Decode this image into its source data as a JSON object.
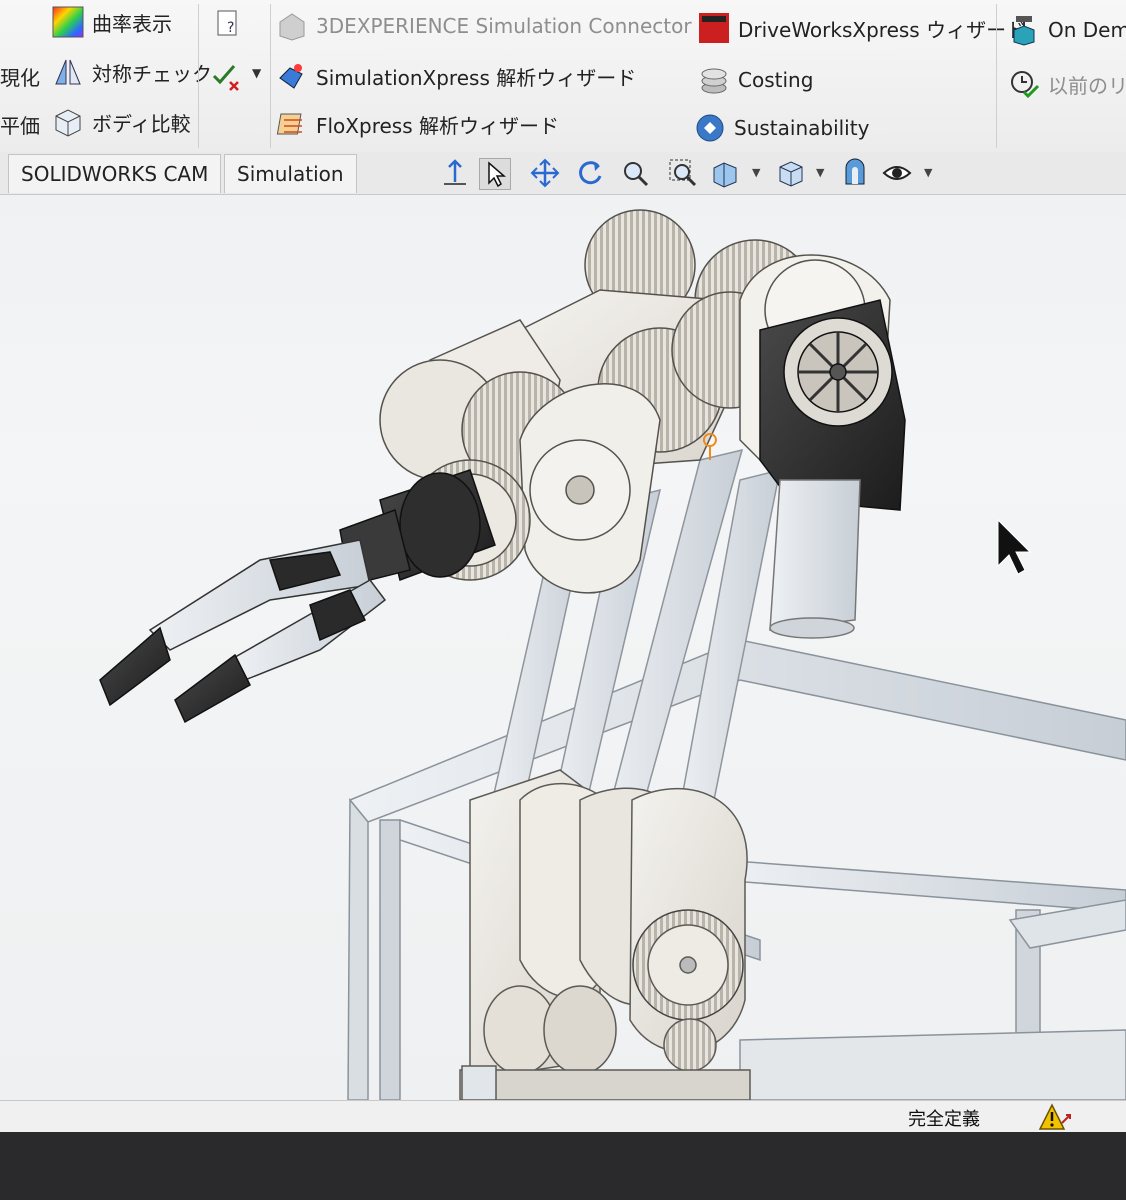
{
  "ribbon": {
    "col1": {
      "curvature": "曲率表示",
      "symmetry_check": "対称チェック",
      "body_compare": "ボディ比較",
      "cut_left_1": "現化",
      "cut_left_2": "平価"
    },
    "sim_connector": "3DEXPERIENCE Simulation Connector",
    "simxpress": "SimulationXpress 解析ウィザード",
    "floxpress": "FloXpress 解析ウィザード",
    "driveworks": "DriveWorksXpress ウィザード",
    "costing": "Costing",
    "sustainability": "Sustainability",
    "on_demand": "On Dem",
    "previous_release": "以前のリ",
    "driveworks_logo_text": "Drive Works"
  },
  "tabs": [
    {
      "label": "SOLIDWORKS CAM"
    },
    {
      "label": "Simulation"
    }
  ],
  "status": {
    "definition": "完全定義"
  },
  "colors": {
    "ribbon_bg": "#efefef",
    "viewport_bg": "#f0f1f2",
    "frame_steel": "#d6dbe0",
    "aluminum": "#e6e4df",
    "dark_part": "#2b2b2b",
    "warning_yellow": "#f2c200"
  }
}
